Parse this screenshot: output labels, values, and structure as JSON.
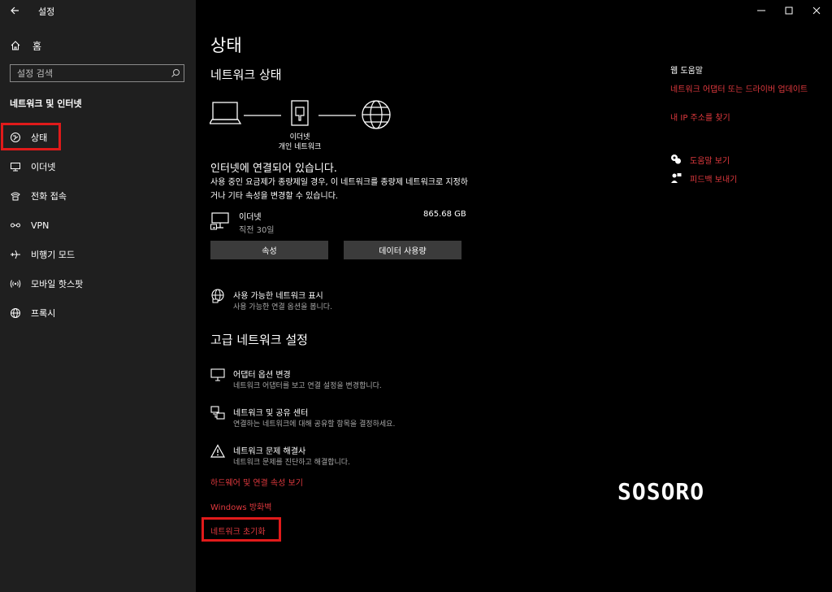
{
  "app": {
    "title": "설정"
  },
  "sidebar": {
    "home_label": "홈",
    "search_placeholder": "설정 검색",
    "section_title": "네트워크 및 인터넷",
    "items": [
      {
        "label": "상태",
        "icon": "status-icon"
      },
      {
        "label": "이더넷",
        "icon": "ethernet-icon"
      },
      {
        "label": "전화 접속",
        "icon": "dialup-icon"
      },
      {
        "label": "VPN",
        "icon": "vpn-icon"
      },
      {
        "label": "비행기 모드",
        "icon": "airplane-icon"
      },
      {
        "label": "모바일 핫스팟",
        "icon": "hotspot-icon"
      },
      {
        "label": "프록시",
        "icon": "globe-icon"
      }
    ]
  },
  "main": {
    "page_title": "상태",
    "network_status_title": "네트워크 상태",
    "diagram_caption_line1": "이더넷",
    "diagram_caption_line2": "개인 네트워크",
    "status_heading": "인터넷에 연결되어 있습니다.",
    "status_desc": "사용 중인 요금제가 종량제일 경우, 이 네트워크를 종량제 네트워크로 지정하거나 기타 속성을 변경할 수 있습니다.",
    "connection": {
      "name": "이더넷",
      "sub": "직전 30일",
      "usage": "865.68 GB"
    },
    "buttons": {
      "properties": "속성",
      "data_usage": "데이터 사용량"
    },
    "available_networks": {
      "title": "사용 가능한 네트워크 표시",
      "sub": "사용 가능한 연결 옵션을 봅니다."
    },
    "advanced_title": "고급 네트워크 설정",
    "advanced_items": [
      {
        "title": "어댑터 옵션 변경",
        "sub": "네트워크 어댑터를 보고 연결 설정을 변경합니다."
      },
      {
        "title": "네트워크 및 공유 센터",
        "sub": "연결하는 네트워크에 대해 공유할 항목을 결정하세요."
      },
      {
        "title": "네트워크 문제 해결사",
        "sub": "네트워크 문제를 진단하고 해결합니다."
      }
    ],
    "links": {
      "hardware": "하드웨어 및 연결 속성 보기",
      "firewall": "Windows 방화벽",
      "reset": "네트워크 초기화"
    }
  },
  "help": {
    "title": "웹 도움말",
    "links": [
      "네트워크 어댑터 또는 드라이버 업데이트",
      "내 IP 주소를 찾기"
    ],
    "get_help": "도움말 보기",
    "feedback": "피드백 보내기"
  },
  "watermark": "SOSORO",
  "colors": {
    "accent_red": "#e0393e",
    "highlight_box": "#e01a1a",
    "sidebar_bg": "#1f1f1f",
    "button_bg": "#3b3b3b"
  }
}
